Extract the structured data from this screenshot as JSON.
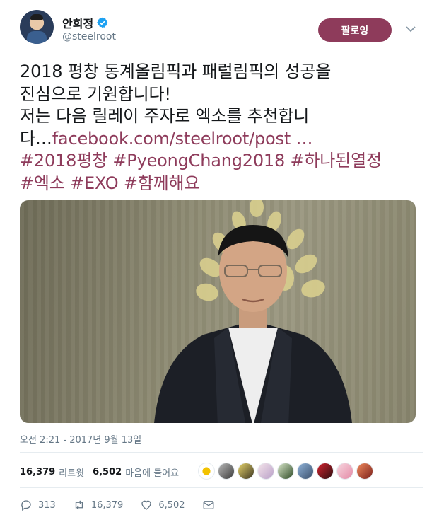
{
  "author": {
    "display_name": "안희정",
    "handle": "@steelroot",
    "verified": true,
    "avatar": "avatar"
  },
  "header": {
    "follow_label": "팔로잉",
    "follow_color": "#8e3b5b",
    "more_icon": "chevron-down-icon"
  },
  "tweet": {
    "line1": "2018 평창 동계올림픽과 패럴림픽의 성공을",
    "line2": "진심으로 기원합니다!",
    "line3": "저는 다음 릴레이 주자로 엑소를 추천합니",
    "line4_prefix": "다…",
    "link": "facebook.com/steelroot/post …",
    "hashtags_row1": [
      "#2018평창",
      "#PyeongChang2018",
      "#하나된열정"
    ],
    "hashtags_row2": [
      "#엑소",
      "#EXO",
      "#함께해요"
    ]
  },
  "timestamp": "오전 2:21 - 2017년 9월 13일",
  "stats": {
    "retweets_count": "16,379",
    "retweets_label": "리트윗",
    "likes_count": "6,502",
    "likes_label": "마음에 들어요"
  },
  "actions": {
    "reply_count": "313",
    "retweet_count": "16,379",
    "like_count": "6,502"
  },
  "colors": {
    "accent": "#8e3b5b",
    "secondary_text": "#657786",
    "verified": "#1da1f2"
  }
}
